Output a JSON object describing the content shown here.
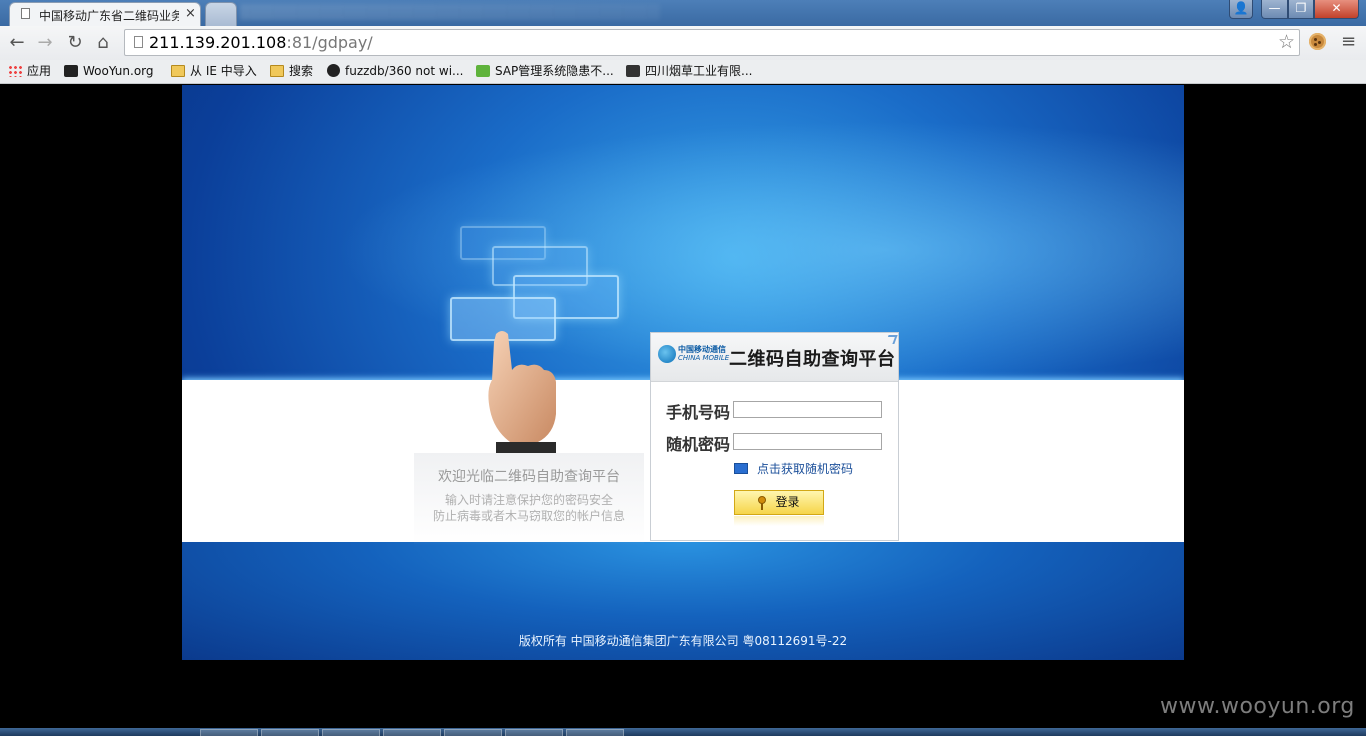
{
  "browser": {
    "tabs": [
      {
        "title": "中国移动广东省二维码业务",
        "active": true
      },
      {
        "title": "",
        "active": false
      }
    ],
    "tab_close": "×",
    "window_buttons": {
      "user": "👤",
      "minimize": "—",
      "maximize": "❐",
      "close": "✕"
    },
    "nav": {
      "back": "←",
      "forward": "→",
      "reload": "↻",
      "home": "⌂"
    },
    "url": {
      "host": "211.139.201.108",
      "rest": ":81/gdpay/"
    },
    "star": "☆",
    "menu": "≡",
    "bookmarks": [
      {
        "label": "应用",
        "icon": "apps-grid-icon"
      },
      {
        "label": "WooYun.org",
        "icon": "wooyun-icon"
      },
      {
        "label": "从 IE 中导入",
        "icon": "folder-icon"
      },
      {
        "label": "搜索",
        "icon": "folder-icon"
      },
      {
        "label": "fuzzdb/360 not wi...",
        "icon": "github-icon"
      },
      {
        "label": "SAP管理系统隐患不...",
        "icon": "sap-icon"
      },
      {
        "label": "四川烟草工业有限...",
        "icon": "tobacco-icon"
      }
    ]
  },
  "page": {
    "welcome": {
      "title": "欢迎光临二维码自助查询平台",
      "line1": "输入时请注意保护您的密码安全",
      "line2": "防止病毒或者木马窃取您的帐户信息"
    },
    "login": {
      "logo_line1": "中国移动通信",
      "logo_line2": "CHINA MOBILE",
      "title": "二维码自助查询平台",
      "phone_label": "手机号码",
      "phone_value": "",
      "password_label": "随机密码",
      "password_value": "",
      "sms_link": "点击获取随机密码",
      "login_button": "登录"
    },
    "footer": "版权所有   中国移动通信集团广东有限公司   粤08112691号-22"
  },
  "watermark": "www.wooyun.org",
  "colors": {
    "page_blue": "#1a6cc8",
    "login_button": "#f6d54a",
    "link": "#1b4f9a"
  }
}
